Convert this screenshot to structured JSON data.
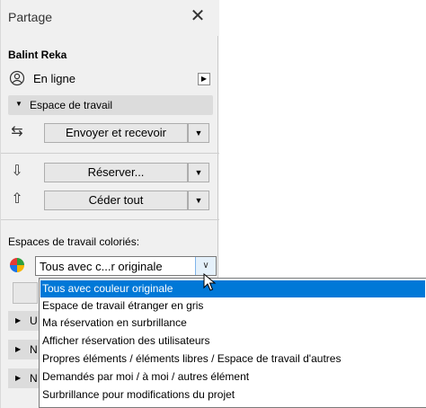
{
  "panel": {
    "title": "Partage",
    "user_name": "Balint Reka",
    "status_label": "En ligne",
    "section_label": "Espace de travail",
    "send_receive_label": "Envoyer et recevoir",
    "reserve_label": "Réserver...",
    "release_all_label": "Céder tout",
    "workspaces_label": "Espaces de travail coloriés:",
    "combo_value": "Tous avec c...r originale",
    "collapsed_sections": [
      {
        "initial": "U"
      },
      {
        "initial": "N"
      },
      {
        "initial": "N"
      }
    ]
  },
  "dropdown": {
    "options": [
      "Tous avec couleur originale",
      "Espace de travail étranger en gris",
      "Ma réservation en surbrillance",
      "Afficher réservation des utilisateurs",
      "Propres éléments / éléments libres / Espace de travail d'autres",
      "Demandés par moi / à moi / autres élément",
      "Surbrillance pour modifications du projet"
    ],
    "selected_index": 0
  },
  "colors": {
    "selection": "#0078d7",
    "panel_bg": "#f0f0f0",
    "section_bg": "#dcdcdc"
  }
}
